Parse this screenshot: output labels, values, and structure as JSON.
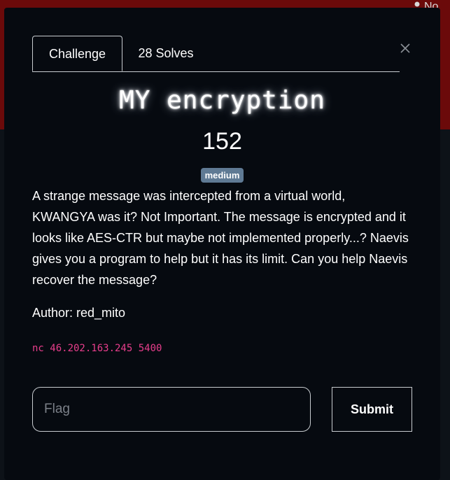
{
  "background": {
    "user_label": "No",
    "band_color": "#6b0a0a"
  },
  "tabs": [
    {
      "label": "Challenge",
      "active": true
    },
    {
      "label": "28 Solves",
      "active": false
    }
  ],
  "challenge": {
    "title": "MY encryption",
    "points": "152",
    "difficulty": "medium",
    "description": "A strange message was intercepted from a virtual world, KWANGYA was it? Not Important. The message is encrypted and it looks like AES-CTR but maybe not implemented properly...? Naevis gives you a program to help but it has its limit. Can you help Naevis recover the message?",
    "author": "Author: red_mito",
    "connection": "nc 46.202.163.245 5400"
  },
  "form": {
    "flag_placeholder": "Flag",
    "flag_value": "",
    "submit_label": "Submit"
  },
  "icons": {
    "close": "close-icon",
    "user": "person-icon"
  }
}
